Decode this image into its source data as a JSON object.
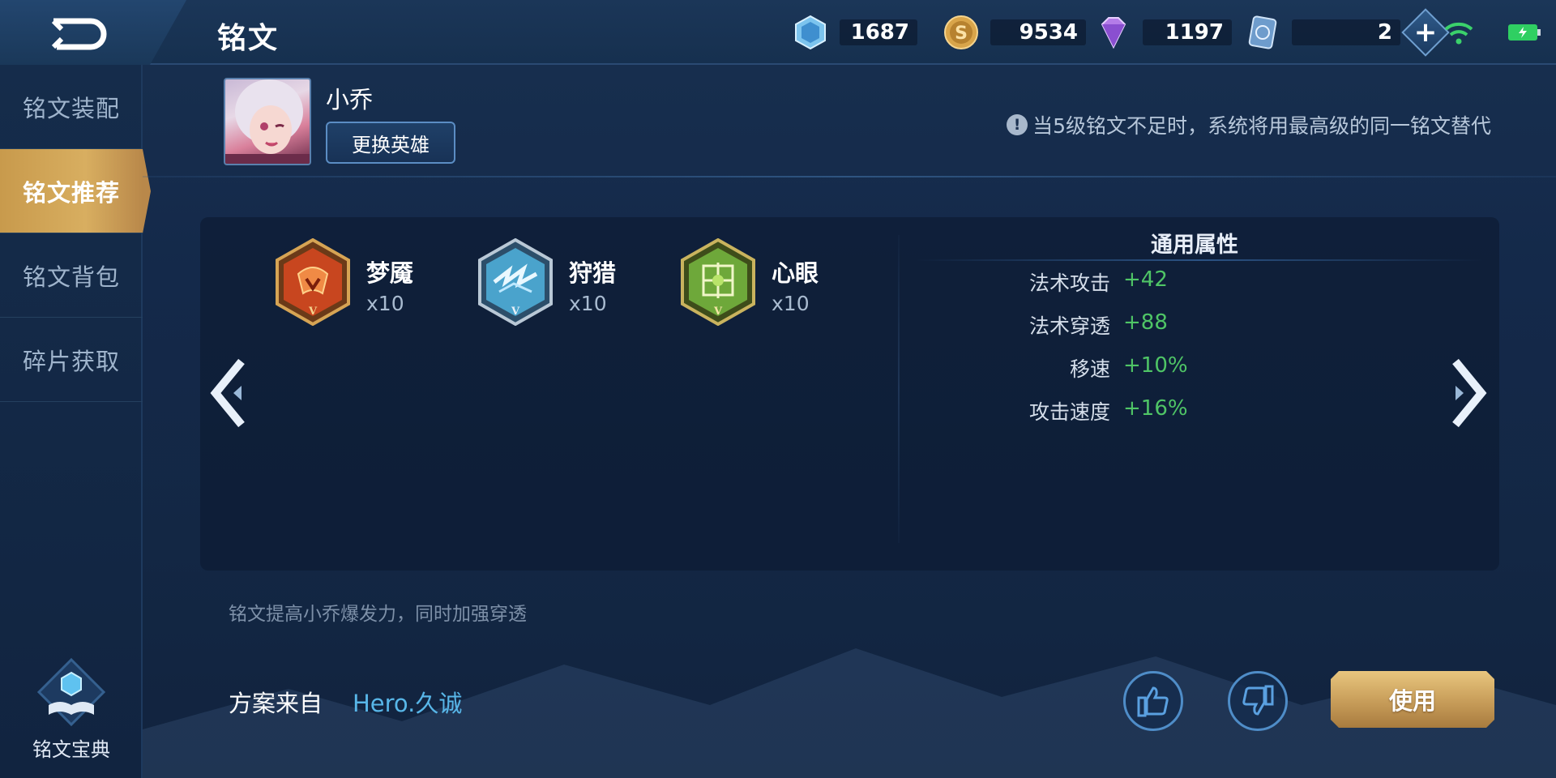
{
  "header": {
    "title": "铭文",
    "resources": [
      {
        "icon": "diamond-crystal-icon",
        "value": "1687"
      },
      {
        "icon": "gold-coin-icon",
        "value": "9534"
      },
      {
        "icon": "purple-gem-icon",
        "value": "1197"
      },
      {
        "icon": "ticket-card-icon",
        "value": "2"
      }
    ],
    "status_icons": [
      "wifi-icon",
      "battery-icon"
    ]
  },
  "sidebar": {
    "items": [
      {
        "label": "铭文装配",
        "active": false
      },
      {
        "label": "铭文推荐",
        "active": true
      },
      {
        "label": "铭文背包",
        "active": false
      },
      {
        "label": "碎片获取",
        "active": false
      }
    ],
    "codex_label": "铭文宝典"
  },
  "hero": {
    "name": "小乔",
    "change_button": "更换英雄"
  },
  "notice": {
    "icon": "info-icon",
    "text": "当5级铭文不足时，系统将用最高级的同一铭文替代"
  },
  "runes": [
    {
      "name": "梦魇",
      "count": "x10",
      "color": "#c8461f",
      "level": "V"
    },
    {
      "name": "狩猎",
      "count": "x10",
      "color": "#4aa3cc",
      "level": "V"
    },
    {
      "name": "心眼",
      "count": "x10",
      "color": "#6ea83a",
      "level": "V"
    }
  ],
  "attributes": {
    "title": "通用属性",
    "rows": [
      {
        "name": "法术攻击",
        "value": "+42"
      },
      {
        "name": "法术穿透",
        "value": "+88"
      },
      {
        "name": "移速",
        "value": "+10%"
      },
      {
        "name": "攻击速度",
        "value": "+16%"
      }
    ]
  },
  "description": "铭文提高小乔爆发力，同时加强穿透",
  "source": {
    "label": "方案来自",
    "author": "Hero.久诚"
  },
  "actions": {
    "use_label": "使用"
  },
  "colors": {
    "accent_gold": "#c89a4c",
    "stat_green": "#4fc566",
    "link_blue": "#58b6e8"
  }
}
